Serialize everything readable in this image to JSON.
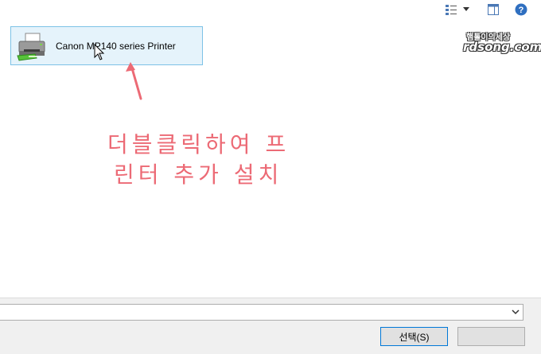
{
  "toolbar": {
    "view_icon": "view-options-icon",
    "view_dropdown_icon": "chevron-down-icon",
    "preview_pane_icon": "preview-pane-icon",
    "help_icon": "help-icon"
  },
  "printer": {
    "name": "Canon MP140 series Printer",
    "icon": "printer-icon"
  },
  "annotation": {
    "line1": "더블클릭하여 프",
    "line2": "린터 추가 설치",
    "color": "#ec6a75"
  },
  "footer": {
    "select_label": "선택(S)",
    "combo_value": ""
  },
  "watermark": {
    "top": "햄톨이의세상",
    "bottom": "rdsong.com"
  },
  "colors": {
    "selection_bg": "#e5f3fb",
    "selection_border": "#7dc2e6",
    "accent": "#0078d7"
  }
}
